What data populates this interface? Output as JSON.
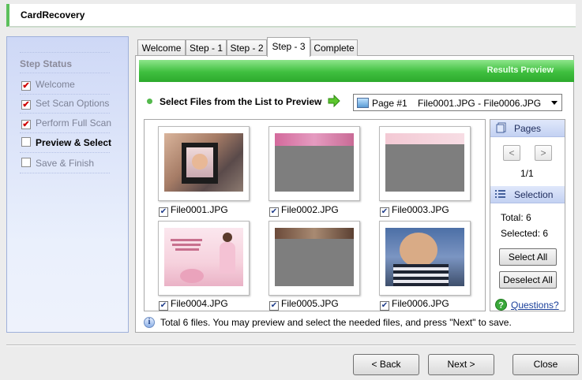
{
  "window": {
    "title": "CardRecovery"
  },
  "left_panel": {
    "heading": "Step Status",
    "steps": [
      {
        "label": "Welcome",
        "checked": true
      },
      {
        "label": "Set Scan Options",
        "checked": true
      },
      {
        "label": "Perform Full Scan",
        "checked": true
      },
      {
        "label": "Preview & Select",
        "checked": false,
        "active": true
      },
      {
        "label": "Save & Finish",
        "checked": false
      }
    ]
  },
  "tabs": [
    "Welcome",
    "Step - 1",
    "Step - 2",
    "Step - 3",
    "Complete"
  ],
  "active_tab": "Step - 3",
  "banner": {
    "label": "Results Preview"
  },
  "select": {
    "prompt": "Select Files from the List to Preview",
    "page_value": "Page #1    File0001.JPG - File0006.JPG"
  },
  "files": [
    {
      "name": "File0001.JPG",
      "checked": true
    },
    {
      "name": "File0002.JPG",
      "checked": true
    },
    {
      "name": "File0003.JPG",
      "checked": true
    },
    {
      "name": "File0004.JPG",
      "checked": true
    },
    {
      "name": "File0005.JPG",
      "checked": true
    },
    {
      "name": "File0006.JPG",
      "checked": true
    }
  ],
  "pages_panel": {
    "heading": "Pages",
    "prev": "<",
    "next": ">",
    "page_count": "1/1"
  },
  "selection_panel": {
    "heading": "Selection",
    "total": "Total: 6",
    "selected": "Selected: 6",
    "select_all": "Select All",
    "deselect_all": "Deselect All",
    "questions": "Questions?"
  },
  "status": {
    "info_glyph": "i",
    "text": "Total 6 files.  You may preview and select the needed files, and press \"Next\" to save."
  },
  "buttons": {
    "back": "< Back",
    "next": "Next >",
    "close": "Close"
  },
  "colors": {
    "accent_green": "#3fbf3f",
    "panel_blue": "#ced8f6",
    "link_blue": "#1a3f9a"
  },
  "check_glyph": "✔"
}
